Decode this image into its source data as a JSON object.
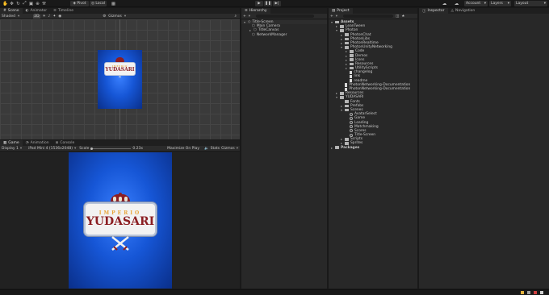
{
  "toolbar": {
    "pivot": "Pivot",
    "local": "Local",
    "account": "Account",
    "layers": "Layers",
    "layout": "Layout"
  },
  "scene": {
    "tabs": [
      "Scene",
      "Animator",
      "Timeline"
    ],
    "shading": "Shaded",
    "two_d": "2D",
    "gizmos": "Gizmos"
  },
  "game": {
    "tabs": [
      "Game",
      "Animation",
      "Console"
    ],
    "display": "Display 1",
    "resolution": "iPad Mini 4 (1536x2048)",
    "scale_label": "Scale",
    "scale_value": "0.23x",
    "maximize": "Maximize On Play",
    "stats": "Stats",
    "gizmos": "Gizmos"
  },
  "logo": {
    "line1": "IMPERIO",
    "line2": "YUDASARI"
  },
  "hierarchy": {
    "title": "Hierarchy",
    "scene_name": "Title-Screen",
    "items": [
      "Main Camera",
      "TitleCanvas",
      "NetworkManager"
    ]
  },
  "project": {
    "title": "Project",
    "tree": [
      {
        "label": "Assets",
        "depth": 0,
        "kind": "folder",
        "arrow": "open",
        "bold": true
      },
      {
        "label": "LeanTween",
        "depth": 1,
        "kind": "folder",
        "arrow": "closed"
      },
      {
        "label": "Photon",
        "depth": 1,
        "kind": "folder",
        "arrow": "open"
      },
      {
        "label": "PhotonChat",
        "depth": 2,
        "kind": "folder",
        "arrow": "closed"
      },
      {
        "label": "PhotonLibs",
        "depth": 2,
        "kind": "folder",
        "arrow": "closed"
      },
      {
        "label": "PhotonRealtime",
        "depth": 2,
        "kind": "folder",
        "arrow": "closed"
      },
      {
        "label": "PhotonUnityNetworking",
        "depth": 2,
        "kind": "folder",
        "arrow": "open"
      },
      {
        "label": "Code",
        "depth": 3,
        "kind": "folder",
        "arrow": "closed"
      },
      {
        "label": "Demos",
        "depth": 3,
        "kind": "folder",
        "arrow": "closed"
      },
      {
        "label": "Icons",
        "depth": 3,
        "kind": "folder",
        "arrow": "closed"
      },
      {
        "label": "Resources",
        "depth": 3,
        "kind": "folder",
        "arrow": "closed"
      },
      {
        "label": "UtilityScripts",
        "depth": 3,
        "kind": "folder",
        "arrow": "closed"
      },
      {
        "label": "changelog",
        "depth": 3,
        "kind": "file",
        "arrow": "none"
      },
      {
        "label": "link",
        "depth": 3,
        "kind": "file",
        "arrow": "none"
      },
      {
        "label": "readme",
        "depth": 3,
        "kind": "file",
        "arrow": "none"
      },
      {
        "label": "PhotonNetworking-Documentation",
        "depth": 2,
        "kind": "file",
        "arrow": "none"
      },
      {
        "label": "PhotonNetworking-Documentation",
        "depth": 2,
        "kind": "file",
        "arrow": "none"
      },
      {
        "label": "Resources",
        "depth": 1,
        "kind": "folder",
        "arrow": "closed"
      },
      {
        "label": "YUDASARI",
        "depth": 1,
        "kind": "folder",
        "arrow": "open"
      },
      {
        "label": "Fonts",
        "depth": 2,
        "kind": "folder",
        "arrow": "none"
      },
      {
        "label": "Prefabs",
        "depth": 2,
        "kind": "folder",
        "arrow": "closed"
      },
      {
        "label": "Scenes",
        "depth": 2,
        "kind": "folder",
        "arrow": "open"
      },
      {
        "label": "AvatarSelect",
        "depth": 3,
        "kind": "scene",
        "arrow": "none"
      },
      {
        "label": "Game",
        "depth": 3,
        "kind": "scene",
        "arrow": "none"
      },
      {
        "label": "Loading",
        "depth": 3,
        "kind": "scene",
        "arrow": "none"
      },
      {
        "label": "Matchmaking",
        "depth": 3,
        "kind": "scene",
        "arrow": "none"
      },
      {
        "label": "Scores",
        "depth": 3,
        "kind": "scene",
        "arrow": "none"
      },
      {
        "label": "Title-Screen",
        "depth": 3,
        "kind": "scene",
        "arrow": "none"
      },
      {
        "label": "Scripts",
        "depth": 2,
        "kind": "folder",
        "arrow": "closed"
      },
      {
        "label": "Sprites",
        "depth": 2,
        "kind": "folder",
        "arrow": "closed"
      },
      {
        "label": "Packages",
        "depth": 0,
        "kind": "folder",
        "arrow": "closed",
        "bold": true
      }
    ]
  },
  "inspector": {
    "tabs": [
      "Inspector",
      "Navigation"
    ]
  },
  "colors": {
    "bg": "#191919",
    "panel": "#282828",
    "scene_grid": "#3a3a3a",
    "blue": "#1656d6",
    "logo_red": "#8b1e22",
    "logo_gold": "#e8a53a"
  }
}
